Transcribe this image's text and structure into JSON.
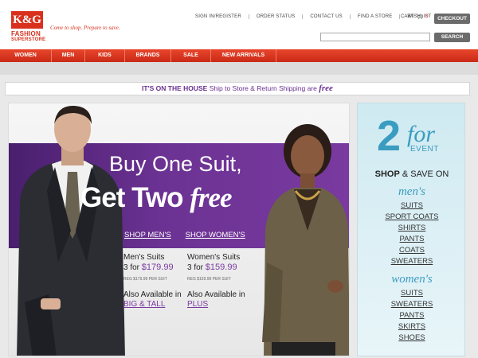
{
  "header": {
    "logo_kg": "K&G",
    "logo_line1": "FASHION",
    "logo_line2": "SUPERSTORE",
    "tagline": "Come to shop. Prepare to save.",
    "util_nav": [
      "SIGN IN/REGISTER",
      "ORDER STATUS",
      "CONTACT US",
      "FIND A STORE",
      "WISHLIST"
    ],
    "cart_label": "CART",
    "cart_count": "0",
    "checkout_label": "CHECKOUT",
    "search_placeholder": "",
    "search_label": "SEARCH"
  },
  "nav": {
    "items": [
      "WOMEN",
      "MEN",
      "KIDS",
      "BRANDS",
      "SALE",
      "NEW ARRIVALS"
    ]
  },
  "promo": {
    "bold": "IT'S ON THE HOUSE",
    "text": "Ship to Store & Return Shipping are",
    "free": "free"
  },
  "hero": {
    "headline1": "Buy One Suit,",
    "headline2": "Get Two",
    "headline2_free": "free",
    "shop_mens": "SHOP MEN'S",
    "shop_womens": "SHOP WOMEN'S",
    "mens": {
      "title": "Men's Suits",
      "price_prefix": "3 for",
      "price": "$179.99",
      "reg": "REG $179.99 PER SUIT",
      "avail": "Also Available in",
      "link": "BIG & TALL"
    },
    "womens": {
      "title": "Women's Suits",
      "price_prefix": "3 for",
      "price": "$159.99",
      "reg": "REG $159.99 PER SUIT",
      "avail": "Also Available in",
      "link": "PLUS"
    }
  },
  "sidebar": {
    "two": "2",
    "for": "for",
    "event": "EVENT",
    "shop": "SHOP",
    "and_save_on": "& SAVE ON",
    "mens_title": "men's",
    "mens_items": [
      "SUITS",
      "SPORT COATS",
      "SHIRTS",
      "PANTS",
      "COATS",
      "SWEATERS"
    ],
    "womens_title": "women's",
    "womens_items": [
      "SUITS",
      "SWEATERS",
      "PANTS",
      "SKIRTS",
      "SHOES"
    ]
  },
  "colors": {
    "brand_red": "#d8301c",
    "purple": "#6b3293",
    "blue": "#3a9cc0"
  }
}
